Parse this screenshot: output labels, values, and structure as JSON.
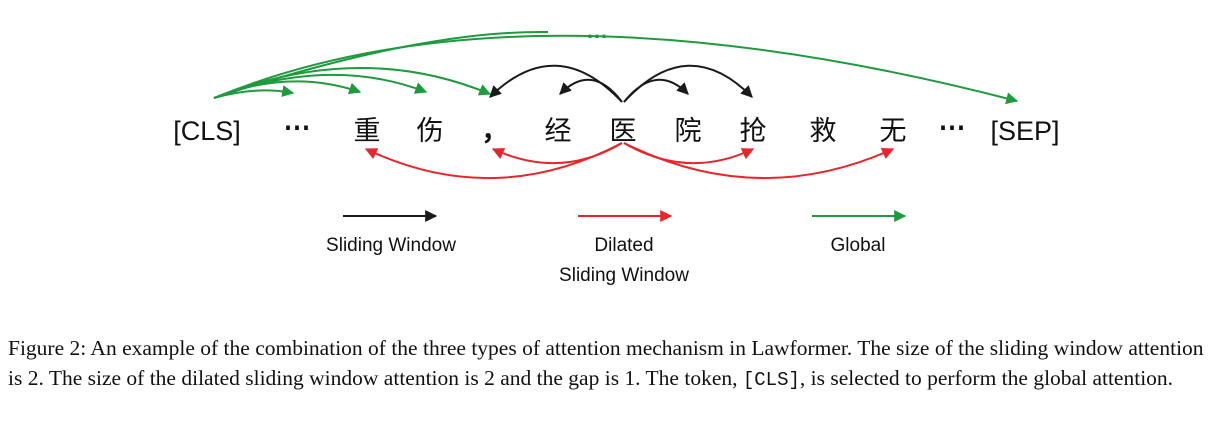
{
  "tokens": [
    "[CLS]",
    "⋯",
    "重",
    "伤",
    "，",
    "经",
    "医",
    "院",
    "抢",
    "救",
    "无",
    "⋯",
    "[SEP]"
  ],
  "global_ellipsis": "…",
  "colors": {
    "sliding": "#1a1a1a",
    "dilated": "#e8252b",
    "global": "#1f9a3e"
  },
  "legend": {
    "sliding_label": "Sliding Window",
    "dilated_label_line1": "Dilated",
    "dilated_label_line2": "Sliding Window",
    "global_label": "Global"
  },
  "caption": {
    "part1": "Figure 2: An example of the combination of the three types of attention mechanism in Lawformer. The size of the sliding window attention is 2. The size of the dilated sliding window attention is 2 and the gap is 1. The token, ",
    "code": "[CLS]",
    "part2": ", is selected to perform the global attention."
  }
}
